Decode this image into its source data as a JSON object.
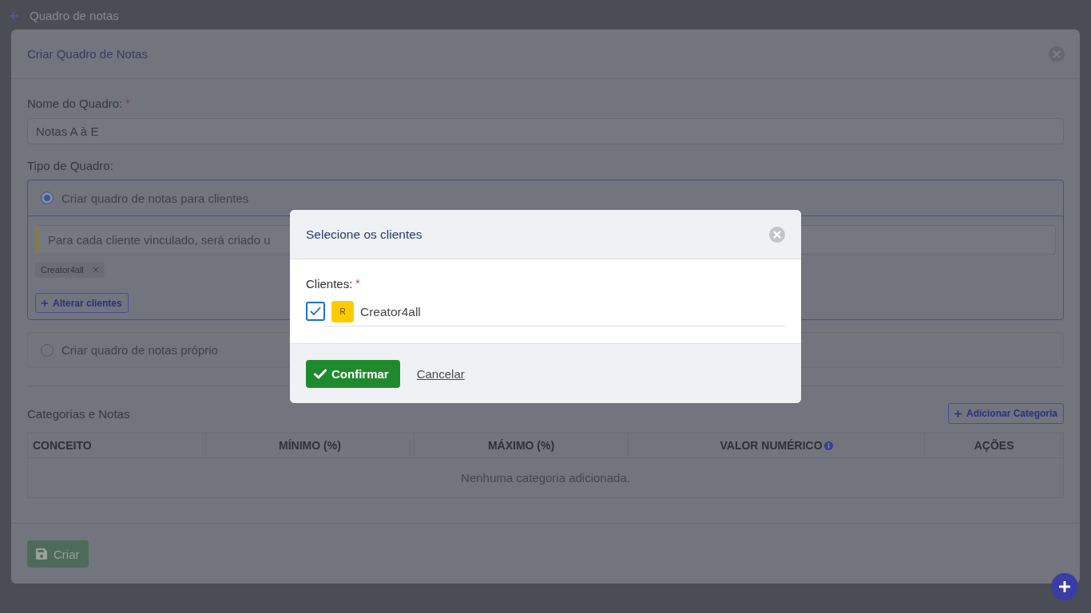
{
  "header": {
    "title": "Quadro de notas"
  },
  "form_card": {
    "title": "Criar Quadro de Notas",
    "name_field": {
      "label": "Nome do Quadro:",
      "required_mark": "*",
      "value": "Notas A à E"
    },
    "type_label": "Tipo de Quadro:",
    "board_types": [
      {
        "label": "Criar quadro de notas para clientes",
        "selected": true,
        "expanded": true,
        "notice": "Para cada cliente vinculado, será criado u",
        "chips": [
          {
            "label": "Creator4all"
          }
        ],
        "action": "Alterar clientes"
      },
      {
        "label": "Criar quadro de notas próprio",
        "selected": false,
        "expanded": false
      }
    ],
    "categories": {
      "title": "Categorias e Notas",
      "add_button": "Adicionar Categoria",
      "columns": [
        {
          "label": "CONCEITO",
          "info": false
        },
        {
          "label": "MÍNIMO (%)",
          "info": false
        },
        {
          "label": "MÁXIMO (%)",
          "info": false
        },
        {
          "label": "VALOR NUMÉRICO",
          "info": true
        },
        {
          "label": "AÇÕES",
          "info": false
        }
      ],
      "empty_text": "Nenhuma categoria adicionada."
    },
    "submit_button": {
      "label": "Criar",
      "disabled": true
    }
  },
  "modal": {
    "title": "Selecione os clientes",
    "field_label": "Clientes:",
    "required_mark": "*",
    "clients": [
      {
        "name": "Creator4all",
        "initial": "R",
        "checked": true
      }
    ],
    "confirm": "Confirmar",
    "cancel": "Cancelar"
  }
}
